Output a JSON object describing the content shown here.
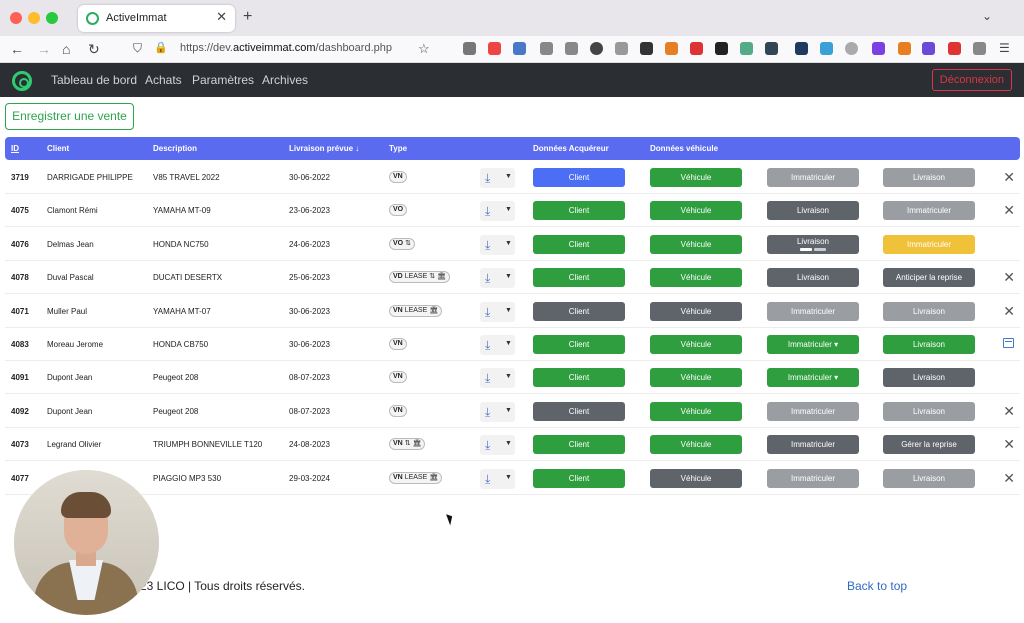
{
  "browser": {
    "tab_title": "ActiveImmat",
    "url_prefix": "https://dev.",
    "url_domain": "activeimmat.com",
    "url_path": "/dashboard.php",
    "icons": [
      "back-icon",
      "forward-icon",
      "home-icon",
      "reload-icon",
      "shield-icon",
      "lock-icon",
      "permissions-icon",
      "bookmark-star-icon",
      "pocket-icon",
      "download-icon",
      "library-icon",
      "sidebar-icon",
      "extension-icons",
      "menu-icon"
    ]
  },
  "navbar": {
    "links": [
      "Tableau de bord",
      "Achats",
      "Paramètres",
      "Archives"
    ],
    "logout_label": "Déconnexion"
  },
  "register_button": "Enregistrer une vente",
  "table": {
    "headers": {
      "id": "ID",
      "client": "Client",
      "description": "Description",
      "delivery": "Livraison prévue ↓",
      "type": "Type",
      "buyer": "Données Acquéreur",
      "vehicle": "Données véhicule"
    },
    "rows": [
      {
        "id": "3719",
        "client": "DARRIGADE PHILIPPE",
        "description": "V85 TRAVEL 2022",
        "date": "30-06-2022",
        "type": "VN",
        "lease": "",
        "icons": "",
        "actions": [
          {
            "label": "Client",
            "color": "blue"
          },
          {
            "label": "Véhicule",
            "color": "green"
          },
          {
            "label": "Immatriculer",
            "color": "grey"
          },
          {
            "label": "Livraison",
            "color": "grey"
          }
        ],
        "end": "delete"
      },
      {
        "id": "4075",
        "client": "Clamont Rémi",
        "description": "YAMAHA MT-09",
        "date": "23-06-2023",
        "type": "VO",
        "lease": "",
        "icons": "",
        "actions": [
          {
            "label": "Client",
            "color": "green"
          },
          {
            "label": "Véhicule",
            "color": "green"
          },
          {
            "label": "Livraison",
            "color": "dark"
          },
          {
            "label": "Immatriculer",
            "color": "grey"
          }
        ],
        "end": "delete"
      },
      {
        "id": "4076",
        "client": "Delmas Jean",
        "description": "HONDA NC750",
        "date": "24-06-2023",
        "type": "VO",
        "lease": "",
        "icons": "⇅",
        "actions": [
          {
            "label": "Client",
            "color": "green"
          },
          {
            "label": "Véhicule",
            "color": "green"
          },
          {
            "label": "Livraison",
            "color": "dark"
          },
          {
            "label": "Immatriculer",
            "color": "yellow"
          }
        ],
        "end": ""
      },
      {
        "id": "4078",
        "client": "Duval Pascal",
        "description": "DUCATI DESERTX",
        "date": "25-06-2023",
        "type": "VD",
        "lease": "LEASE",
        "icons": "⇅ 🏛",
        "actions": [
          {
            "label": "Client",
            "color": "green"
          },
          {
            "label": "Véhicule",
            "color": "green"
          },
          {
            "label": "Livraison",
            "color": "dark"
          },
          {
            "label": "Anticiper la reprise",
            "color": "dark"
          }
        ],
        "end": "delete"
      },
      {
        "id": "4071",
        "client": "Muller Paul",
        "description": "YAMAHA MT-07",
        "date": "30-06-2023",
        "type": "VN",
        "lease": "LEASE",
        "icons": "🏛",
        "actions": [
          {
            "label": "Client",
            "color": "dark"
          },
          {
            "label": "Véhicule",
            "color": "dark"
          },
          {
            "label": "Immatriculer",
            "color": "grey"
          },
          {
            "label": "Livraison",
            "color": "grey"
          }
        ],
        "end": "delete"
      },
      {
        "id": "4083",
        "client": "Moreau Jerome",
        "description": "HONDA CB750",
        "date": "30-06-2023",
        "type": "VN",
        "lease": "",
        "icons": "",
        "actions": [
          {
            "label": "Client",
            "color": "green"
          },
          {
            "label": "Véhicule",
            "color": "green"
          },
          {
            "label": "Immatriculer ▾",
            "color": "green"
          },
          {
            "label": "Livraison",
            "color": "green"
          }
        ],
        "end": "archive"
      },
      {
        "id": "4091",
        "client": "Dupont Jean",
        "description": "Peugeot 208",
        "date": "08-07-2023",
        "type": "VN",
        "lease": "",
        "icons": "",
        "actions": [
          {
            "label": "Client",
            "color": "green"
          },
          {
            "label": "Véhicule",
            "color": "green"
          },
          {
            "label": "Immatriculer ▾",
            "color": "green"
          },
          {
            "label": "Livraison",
            "color": "dark"
          }
        ],
        "end": ""
      },
      {
        "id": "4092",
        "client": "Dupont Jean",
        "description": "Peugeot 208",
        "date": "08-07-2023",
        "type": "VN",
        "lease": "",
        "icons": "",
        "actions": [
          {
            "label": "Client",
            "color": "dark"
          },
          {
            "label": "Véhicule",
            "color": "green"
          },
          {
            "label": "Immatriculer",
            "color": "grey"
          },
          {
            "label": "Livraison",
            "color": "grey"
          }
        ],
        "end": "delete"
      },
      {
        "id": "4073",
        "client": "Legrand Olivier",
        "description": "TRIUMPH BONNEVILLE T120",
        "date": "24-08-2023",
        "type": "VN",
        "lease": "",
        "icons": "⇅ 🏛",
        "actions": [
          {
            "label": "Client",
            "color": "green"
          },
          {
            "label": "Véhicule",
            "color": "green"
          },
          {
            "label": "Immatriculer",
            "color": "dark"
          },
          {
            "label": "Gérer la reprise",
            "color": "dark"
          }
        ],
        "end": "delete"
      },
      {
        "id": "4077",
        "client": "",
        "description": "PIAGGIO MP3 530",
        "date": "29-03-2024",
        "type": "VN",
        "lease": "LEASE",
        "icons": "🏛",
        "actions": [
          {
            "label": "Client",
            "color": "green"
          },
          {
            "label": "Véhicule",
            "color": "dark"
          },
          {
            "label": "Immatriculer",
            "color": "grey"
          },
          {
            "label": "Livraison",
            "color": "grey"
          }
        ],
        "end": "delete"
      }
    ]
  },
  "footer": {
    "copyright": "23 LICO | Tous droits réservés.",
    "back_to_top": "Back to top"
  }
}
